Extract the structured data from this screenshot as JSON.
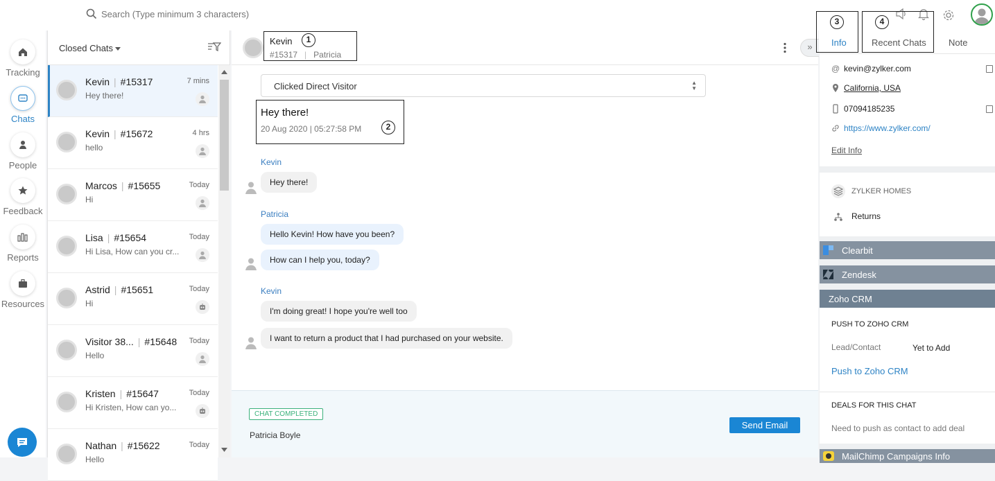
{
  "topbar": {
    "search_placeholder": "Search (Type minimum 3 characters)"
  },
  "nav": {
    "items": [
      {
        "label": "Tracking",
        "icon": "home-icon"
      },
      {
        "label": "Chats",
        "icon": "chat-icon"
      },
      {
        "label": "People",
        "icon": "person-icon"
      },
      {
        "label": "Feedback",
        "icon": "star-icon"
      },
      {
        "label": "Reports",
        "icon": "bar-chart-icon"
      },
      {
        "label": "Resources",
        "icon": "briefcase-icon"
      }
    ],
    "active": "Chats"
  },
  "chatlist": {
    "title": "Closed Chats",
    "items": [
      {
        "name": "Kevin",
        "id": "#15317",
        "time": "7 mins",
        "message": "Hey there!",
        "status": "agent"
      },
      {
        "name": "Kevin",
        "id": "#15672",
        "time": "4 hrs",
        "message": "hello",
        "status": "agent"
      },
      {
        "name": "Marcos",
        "id": "#15655",
        "time": "Today",
        "message": "Hi",
        "status": "agent"
      },
      {
        "name": "Lisa",
        "id": "#15654",
        "time": "Today",
        "message": "Hi Lisa, How can you cr...",
        "status": "agent"
      },
      {
        "name": "Astrid",
        "id": "#15651",
        "time": "Today",
        "message": "Hi",
        "status": "bot"
      },
      {
        "name": "Visitor 38...",
        "id": "#15648",
        "time": "Today",
        "message": "Hello",
        "status": "agent"
      },
      {
        "name": "Kristen",
        "id": "#15647",
        "time": "Today",
        "message": "Hi Kristen, How can yo...",
        "status": "bot"
      },
      {
        "name": "Nathan",
        "id": "#15622",
        "time": "Today",
        "message": "Hello",
        "status": "agent"
      }
    ]
  },
  "conversation": {
    "visitor_name": "Kevin",
    "chat_id": "#15317",
    "agent_name": "Patricia",
    "annotations": {
      "one": "1",
      "two": "2",
      "three": "3",
      "four": "4"
    },
    "expand_label": "»",
    "source_dropdown": "Clicked Direct Visitor",
    "first_message": "Hey there!",
    "first_message_time": "20 Aug 2020 | 05:27:58 PM",
    "messages": [
      {
        "sender": "Kevin",
        "texts": [
          "Hey there!"
        ],
        "role": "visitor"
      },
      {
        "sender": "Patricia",
        "texts": [
          "Hello Kevin! How have you been?",
          "How can I help you, today?"
        ],
        "role": "agent"
      },
      {
        "sender": "Kevin",
        "texts": [
          "I'm doing great! I hope you're well too",
          "I want to return a product that I had purchased on your website."
        ],
        "role": "visitor"
      }
    ],
    "status_tag": "CHAT COMPLETED",
    "completed_by": "Patricia Boyle",
    "send_email_label": "Send Email"
  },
  "rightpanel": {
    "tabs": [
      "Info",
      "Recent Chats",
      "Note"
    ],
    "active_tab": "Info",
    "email": "kevin@zylker.com",
    "location": "California, USA",
    "phone": "07094185235",
    "website": "https://www.zylker.com/",
    "edit_info": "Edit Info",
    "company": "ZYLKER HOMES",
    "department": "Returns",
    "integrations": {
      "clearbit": "Clearbit",
      "zendesk": "Zendesk",
      "zoho_crm": "Zoho CRM",
      "mailchimp": "MailChimp Campaigns Info"
    },
    "crm": {
      "push_heading": "PUSH TO ZOHO CRM",
      "lead_label": "Lead/Contact",
      "lead_value": "Yet to Add",
      "push_link": "Push to Zoho CRM",
      "deals_heading": "DEALS FOR THIS CHAT",
      "deals_note": "Need to push as contact to add deal"
    }
  },
  "colors": {
    "accent": "#2d83c5",
    "send_button": "#1a86d4",
    "completed_green": "#3bb17b",
    "integration_bar": "#8592a0",
    "zoho_bar": "#6f8192"
  }
}
